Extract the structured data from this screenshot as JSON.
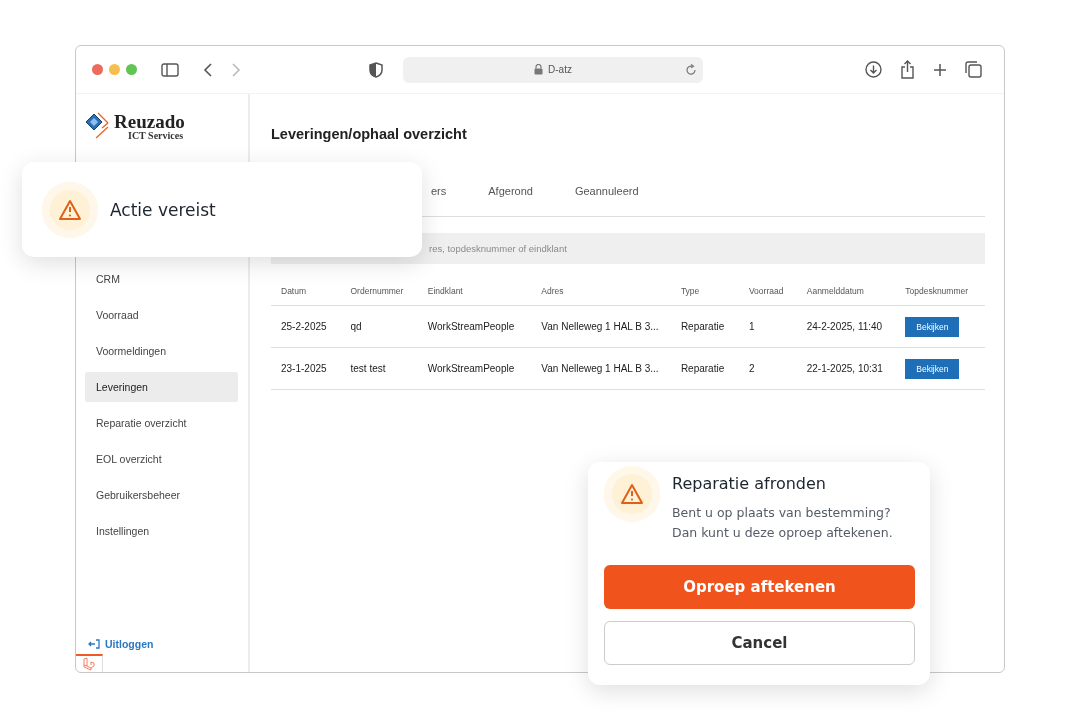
{
  "browser": {
    "address": "D-atz"
  },
  "logo": {
    "name": "Reuzado",
    "tagline": "ICT Services"
  },
  "sidebar": {
    "items": [
      {
        "label": "CRM",
        "selected": false
      },
      {
        "label": "Voorraad",
        "selected": false
      },
      {
        "label": "Voormeldingen",
        "selected": false
      },
      {
        "label": "Leveringen",
        "selected": true
      },
      {
        "label": "Reparatie overzicht",
        "selected": false
      },
      {
        "label": "EOL overzicht",
        "selected": false
      },
      {
        "label": "Gebruikersbeheer",
        "selected": false
      },
      {
        "label": "Instellingen",
        "selected": false
      }
    ],
    "logout": "Uitloggen"
  },
  "page": {
    "title": "Leveringen/ophaal overzicht"
  },
  "tabs": [
    {
      "label": "ers",
      "selected": false
    },
    {
      "label": "Afgerond",
      "selected": false
    },
    {
      "label": "Geannuleerd",
      "selected": false
    }
  ],
  "search": {
    "placeholder": "res, topdesknummer of eindklant"
  },
  "table": {
    "columns": [
      "Datum",
      "Ordernummer",
      "Eindklant",
      "Adres",
      "Type",
      "Voorraad",
      "Aanmelddatum",
      "Topdesknummer"
    ],
    "rows": [
      {
        "cells": [
          "25-2-2025",
          "qd",
          "WorkStreamPeople",
          "Van Nelleweg 1 HAL B 3...",
          "Reparatie",
          "1",
          "24-2-2025, 11:40"
        ],
        "action": "Bekijken"
      },
      {
        "cells": [
          "23-1-2025",
          "test test",
          "WorkStreamPeople",
          "Van Nelleweg 1 HAL B 3...",
          "Reparatie",
          "2",
          "22-1-2025, 10:31"
        ],
        "action": "Bekijken"
      }
    ]
  },
  "toast": {
    "title": "Actie vereist"
  },
  "dialog": {
    "title": "Reparatie afronden",
    "message_lines": [
      "Bent u op plaats van bestemming?",
      "Dan kunt u deze oproep aftekenen."
    ],
    "confirm": "Oproep aftekenen",
    "cancel": "Cancel"
  }
}
